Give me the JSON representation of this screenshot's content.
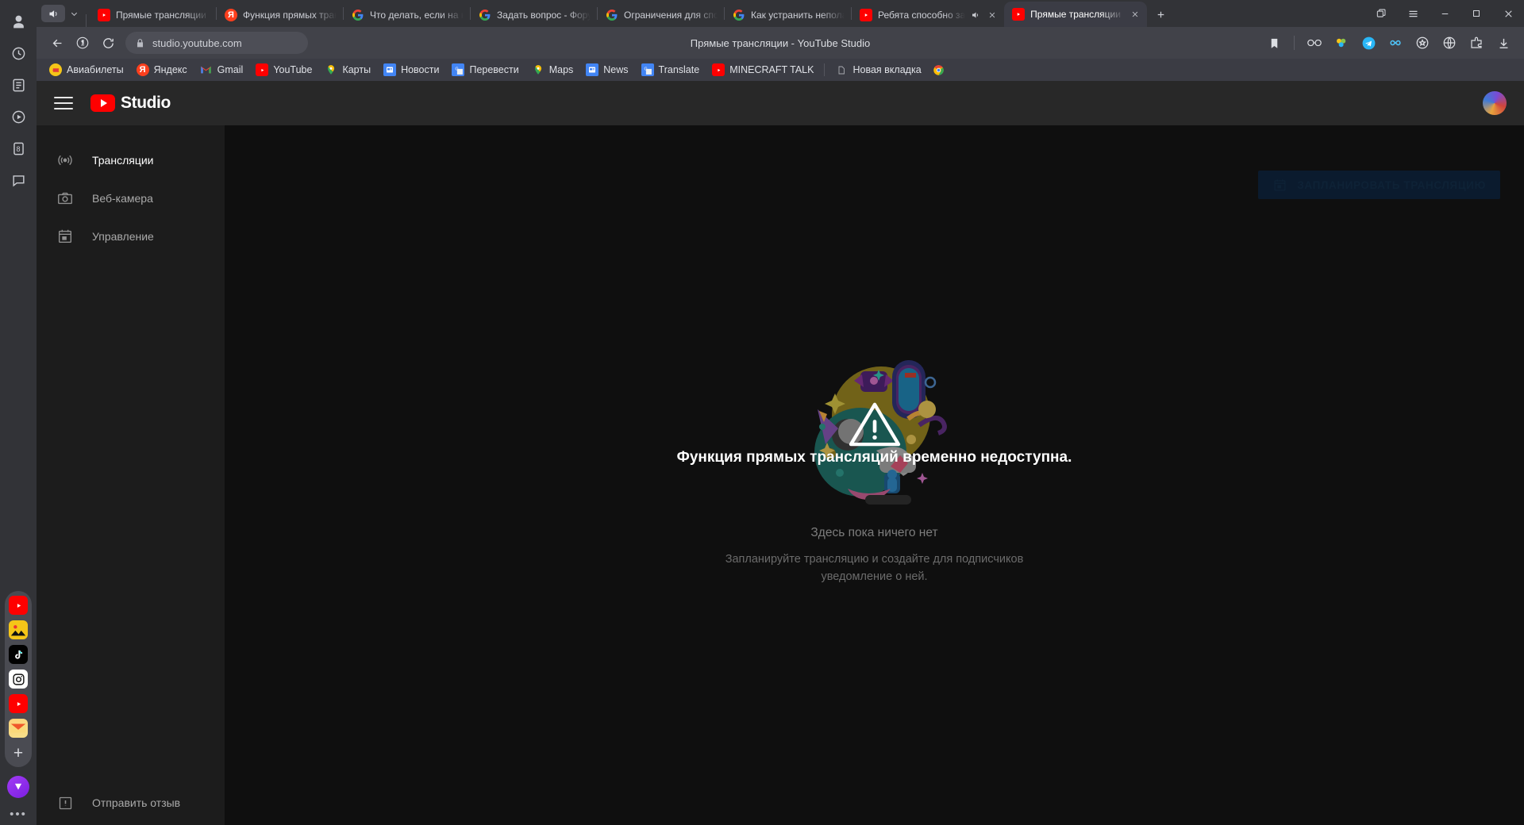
{
  "browser": {
    "window_controls": {
      "minimize": "–",
      "maximize": "□",
      "close": "✕"
    },
    "new_tab_label": "+",
    "sound_button": "sound-icon",
    "tabs": [
      {
        "title": "Прямые трансляции - YouTube Studio",
        "favicon": "youtube",
        "active": false,
        "muted": false
      },
      {
        "title": "Функция прямых трансляций",
        "favicon": "yandex",
        "active": false,
        "muted": false
      },
      {
        "title": "Что делать, если на канале",
        "favicon": "google",
        "active": false,
        "muted": false
      },
      {
        "title": "Задать вопрос - Форум",
        "favicon": "google",
        "active": false,
        "muted": false
      },
      {
        "title": "Ограничения для спорных",
        "favicon": "google",
        "active": false,
        "muted": false
      },
      {
        "title": "Как устранить неполадки",
        "favicon": "google",
        "active": false,
        "muted": false
      },
      {
        "title": "Ребята способно за",
        "favicon": "youtube",
        "active": false,
        "muted": true
      },
      {
        "title": "Прямые трансляции -",
        "favicon": "youtube",
        "active": true,
        "muted": false
      }
    ],
    "toolbar": {
      "back": "back-icon",
      "yandex": "yandex-icon",
      "reload": "reload-icon",
      "lock": "lock-icon",
      "url": "studio.youtube.com",
      "page_title": "Прямые трансляции - YouTube Studio",
      "right_icons": [
        "bookmark-icon",
        "glasses-icon",
        "colorful-dots-icon",
        "telegram-icon",
        "infinity-icon",
        "shield-icon",
        "globe-icon",
        "extensions-icon",
        "download-icon"
      ]
    },
    "bookmarks": [
      {
        "label": "Авиабилеты",
        "icon": "ticket"
      },
      {
        "label": "Яндекс",
        "icon": "yandex"
      },
      {
        "label": "Gmail",
        "icon": "gmail"
      },
      {
        "label": "YouTube",
        "icon": "youtube"
      },
      {
        "label": "Карты",
        "icon": "maps"
      },
      {
        "label": "Новости",
        "icon": "news"
      },
      {
        "label": "Перевести",
        "icon": "translate"
      },
      {
        "label": "Maps",
        "icon": "maps"
      },
      {
        "label": "News",
        "icon": "news"
      },
      {
        "label": "Translate",
        "icon": "translate"
      },
      {
        "label": "MINECRAFT TALK",
        "icon": "youtube"
      },
      {
        "label": "Новая вкладка",
        "icon": "page"
      }
    ],
    "left_rail": {
      "top_icons": [
        "profile-icon",
        "history-icon",
        "reading-list-icon",
        "video-icon",
        "notes-icon",
        "chat-icon"
      ],
      "badge_value": "8",
      "app_icons": [
        "youtube-app",
        "photos-app",
        "tiktok-app",
        "instagram-app",
        "youtube2-app",
        "mail-app"
      ],
      "add_label": "+",
      "more_label": "•••"
    }
  },
  "studio": {
    "logo_text": "Studio",
    "menu_icon": "hamburger-icon",
    "avatar": "user-avatar",
    "sidebar": [
      {
        "label": "Трансляции",
        "icon": "broadcast-icon",
        "selected": true
      },
      {
        "label": "Веб-камера",
        "icon": "webcam-icon",
        "selected": false
      },
      {
        "label": "Управление",
        "icon": "manage-icon",
        "selected": false
      }
    ],
    "feedback_label": "Отправить отзыв",
    "feedback_icon": "feedback-icon",
    "schedule_button": {
      "label": "ЗАПЛАНИРОВАТЬ ТРАНСЛЯЦИЮ",
      "icon": "calendar-icon"
    },
    "empty_state": {
      "headline": "Функция прямых трансляций временно недоступна.",
      "title": "Здесь пока ничего нет",
      "description": "Запланируйте трансляцию и создайте для подписчиков уведомление о ней.",
      "warning_icon": "warning-triangle-icon"
    }
  },
  "colors": {
    "youtube_red": "#ff0000",
    "page_bg": "#0f0f0f",
    "sidebar_bg": "#1c1c1c",
    "header_bg": "#282828",
    "chrome_bg": "#323337"
  }
}
